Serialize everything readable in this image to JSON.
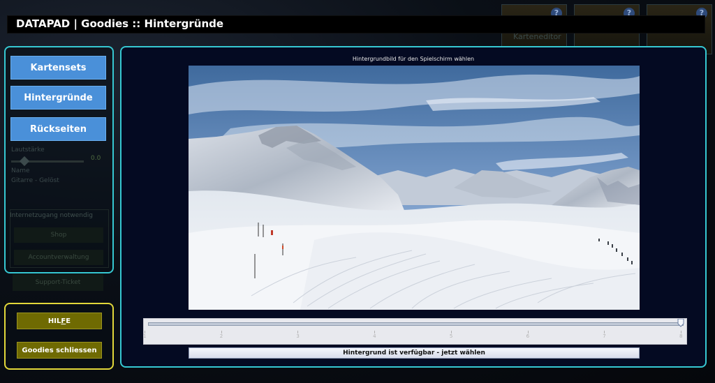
{
  "window": {
    "title": "DATAPAD | Goodies :: Hintergründe"
  },
  "background": {
    "tiles": [
      {
        "icon": "question-icon",
        "label": "?"
      },
      {
        "icon": "question-icon",
        "label": "?"
      },
      {
        "icon": "question-icon",
        "label": "?"
      }
    ],
    "card_editor_label": "Karteneditor",
    "slider_label_top": "Lautstärke",
    "slider_value": "0.0",
    "name_label": "Name",
    "name_value": "Gitarre - Gelöst",
    "section_title": "Internetzugang notwendig",
    "shop_label": "Shop",
    "account_label": "Accountverwaltung",
    "support_label": "Support-Ticket"
  },
  "sidebar": {
    "items": [
      {
        "label": "Kartensets"
      },
      {
        "label": "Hintergründe"
      },
      {
        "label": "Rückseiten"
      }
    ],
    "help_label_pre": "HIL",
    "help_label_accel": "F",
    "help_label_post": "E",
    "close_label": "Goodies schliessen"
  },
  "main": {
    "heading": "Hintergrundbild für den Spielschirm wählen",
    "slider": {
      "min": 1,
      "max": 8,
      "value": 8,
      "tick_labels": [
        "1",
        "2",
        "3",
        "4",
        "5",
        "6",
        "7",
        "8"
      ]
    },
    "select_label": "Hintergrund ist verfügbar - jetzt wählen"
  },
  "colors": {
    "panel_border": "#36c8d2",
    "help_border": "#e2d83a",
    "nav_button": "#4a90d9",
    "olive_button": "#6f6a02",
    "main_background": "#040a22"
  }
}
